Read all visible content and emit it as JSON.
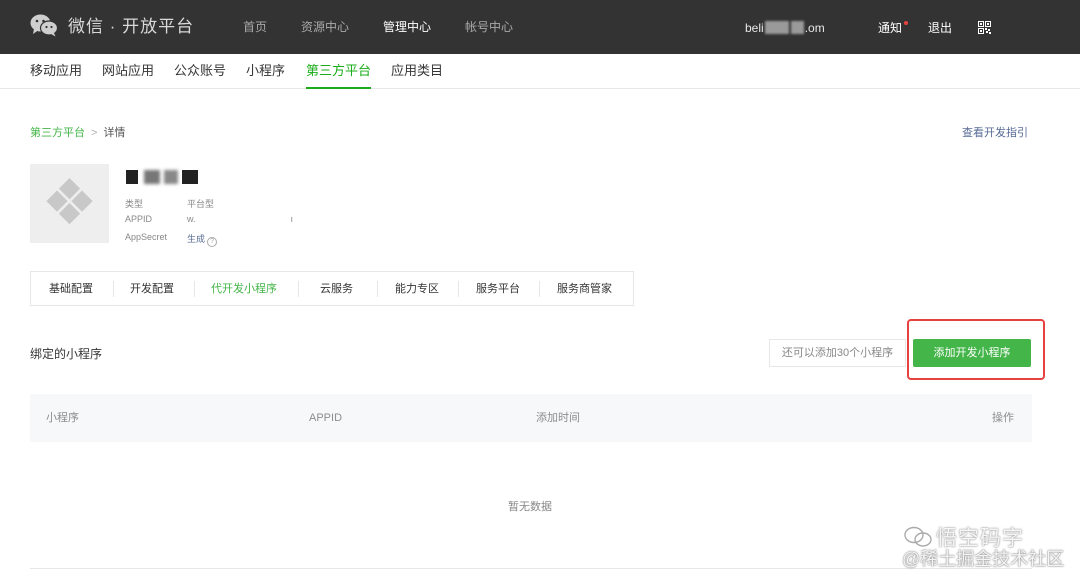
{
  "header": {
    "logo_text": "微信 · 开放平台",
    "nav": [
      "首页",
      "资源中心",
      "管理中心",
      "帐号中心"
    ],
    "active_nav": "管理中心",
    "email_prefix": "beli",
    "email_suffix": ".om",
    "notice_label": "通知",
    "logout_label": "退出"
  },
  "subnav": {
    "items": [
      "移动应用",
      "网站应用",
      "公众账号",
      "小程序",
      "第三方平台",
      "应用类目"
    ],
    "active": "第三方平台"
  },
  "breadcrumb": {
    "parent": "第三方平台",
    "current": "详情",
    "separator": ">"
  },
  "dev_guide_link": "查看开发指引",
  "app": {
    "type_label": "类型",
    "type_value": "平台型",
    "appid_label": "APPID",
    "appid_value": "w.",
    "secret_label": "AppSecret",
    "secret_action": "生成",
    "help_icon": "?"
  },
  "tabs": {
    "items": [
      "基础配置",
      "开发配置",
      "代开发小程序",
      "云服务",
      "能力专区",
      "服务平台",
      "服务商管家"
    ],
    "active": "代开发小程序"
  },
  "bound": {
    "title": "绑定的小程序",
    "remaining": "还可以添加30个小程序",
    "add_button": "添加开发小程序"
  },
  "table": {
    "columns": [
      "小程序",
      "APPID",
      "添加时间",
      "操作"
    ],
    "empty_text": "暂无数据"
  },
  "watermark": {
    "line1": "悟空码字",
    "line2": "@稀土掘金技术社区"
  },
  "colors": {
    "topbar": "#333333",
    "brand_green": "#44b549",
    "link_blue": "#576b95",
    "highlight_red": "#e64340"
  }
}
